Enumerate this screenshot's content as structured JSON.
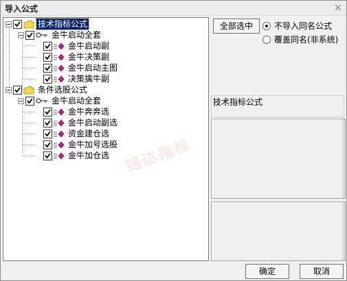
{
  "window": {
    "title": "导入公式"
  },
  "tree": {
    "root1": {
      "label": "技术指标公式"
    },
    "group1": {
      "label": "金牛启动全套"
    },
    "items1": [
      "金牛启动副",
      "金牛决策副",
      "金牛启动主图",
      "决策擒牛副"
    ],
    "root2": {
      "label": "条件选股公式"
    },
    "group2": {
      "label": "金牛启动全套"
    },
    "items2": [
      "金牛奔奔选",
      "金牛启动副选",
      "资金建仓选",
      "金牛加号选股",
      "金牛加仓选"
    ]
  },
  "watermark": "铭达指标",
  "actions": {
    "select_all": "全部选中",
    "radio_skip": "不导入同名公式",
    "radio_overwrite": "覆盖同名(非系统)",
    "radio_selected": "radio_skip"
  },
  "detail": {
    "formula_name": "技术指标公式"
  },
  "footer": {
    "ok": "确定",
    "cancel": "取消"
  },
  "colors": {
    "selection": "#0a246a",
    "leaf_icon": "#c0208a",
    "folder": "#f7d24d"
  }
}
